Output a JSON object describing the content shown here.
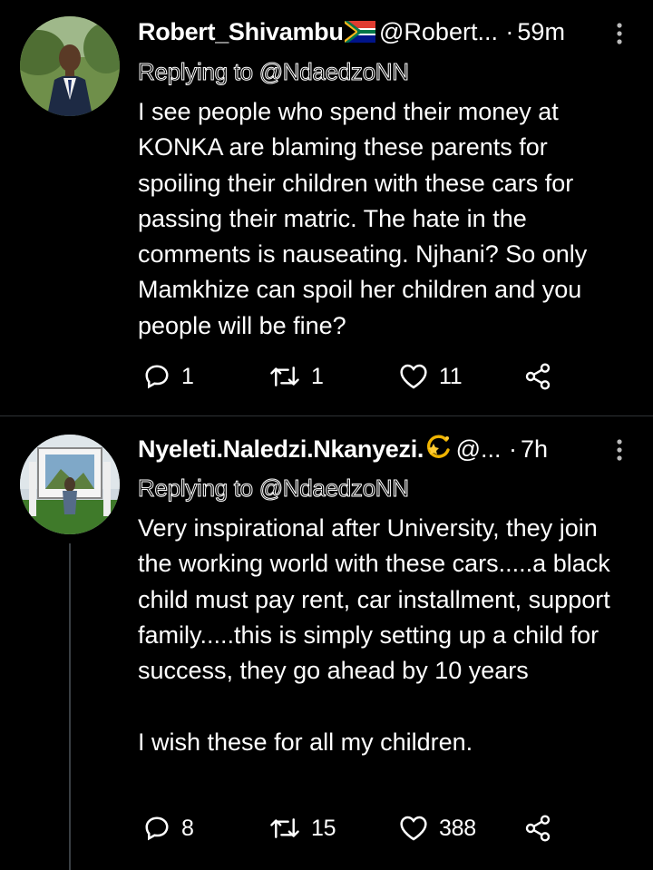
{
  "tweets": [
    {
      "author": "Robert_Shivambu",
      "author_emoji": "south-africa-flag",
      "handle": "@Robert...",
      "separator": "·",
      "time": "59m",
      "replying_to": "Replying to @NdaedzoNN",
      "text": "I see people who spend their money at KONKA are blaming these parents for spoiling their children with these cars for passing their matric. The hate in the comments is nauseating. Njhani? So only Mamkhize can spoil her children and you people will be fine?",
      "replies": "1",
      "retweets": "1",
      "likes": "11"
    },
    {
      "author": "Nyeleti.Naledzi.Nkanyezi.",
      "author_emoji": "dizzy-star",
      "handle": "@...",
      "separator": "·",
      "time": "7h",
      "replying_to": "Replying to @NdaedzoNN",
      "text": "Very inspirational after University, they join the working world with these cars.....a black child must pay rent, car installment, support family.....this is simply setting up a child for success, they go ahead by 10 years\n\nI wish these for all my children.",
      "replies": "8",
      "retweets": "15",
      "likes": "388"
    }
  ],
  "colors": {
    "background": "#000000",
    "text": "#ffffff",
    "divider": "#2f3336",
    "thread_line": "#3a3f44"
  }
}
